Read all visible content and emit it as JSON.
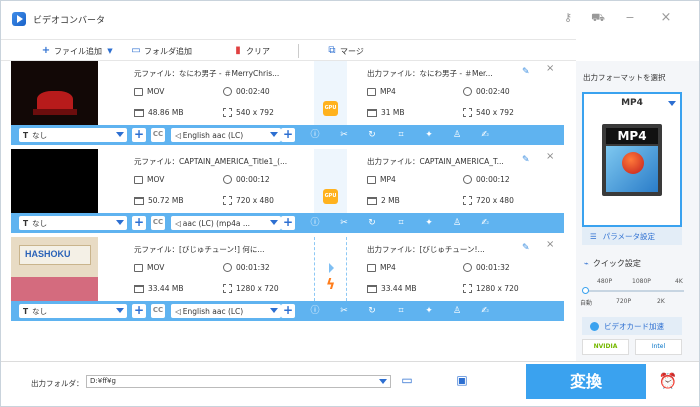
{
  "app": {
    "title": "ビデオコンバータ"
  },
  "toolbar": {
    "add_file": "ファイル追加",
    "add_folder": "フォルダ追加",
    "clear": "クリア",
    "merge": "マージ"
  },
  "files": [
    {
      "src_name": "元ファイル：なにわ男子 - ＃MerryChris...",
      "out_name": "出力ファイル：なにわ男子 - ＃Mer...",
      "src_format": "MOV",
      "src_duration": "00:02:40",
      "src_size": "48.86 MB",
      "src_resolution": "540 x 792",
      "out_format": "MP4",
      "out_duration": "00:02:40",
      "out_size": "31 MB",
      "out_resolution": "540 x 792",
      "accel": "gpu",
      "subtitle": "なし",
      "audio": "English aac (LC)"
    },
    {
      "src_name": "元ファイル：CAPTAIN_AMERICA_Title1_(...",
      "out_name": "出力ファイル：CAPTAIN_AMERICA_T...",
      "src_format": "MOV",
      "src_duration": "00:00:12",
      "src_size": "50.72 MB",
      "src_resolution": "720 x 480",
      "out_format": "MP4",
      "out_duration": "00:00:12",
      "out_size": "2 MB",
      "out_resolution": "720 x 480",
      "accel": "gpu",
      "subtitle": "なし",
      "audio": "aac (LC) (mp4a ..."
    },
    {
      "src_name": "元ファイル：[びじゅチューン!] 何に...",
      "out_name": "出力ファイル：[びじゅチューン!...",
      "src_format": "MOV",
      "src_duration": "00:01:32",
      "src_size": "33.44 MB",
      "src_resolution": "1280 x 720",
      "out_format": "MP4",
      "out_duration": "00:01:32",
      "out_size": "33.44 MB",
      "out_resolution": "1280 x 720",
      "accel": "bolt",
      "subtitle": "なし",
      "audio": "English aac (LC)"
    }
  ],
  "gpu_label": "GPU",
  "right_panel": {
    "select_format": "出力フォーマットを選択",
    "format": "MP4",
    "format_badge": "MP4",
    "param_settings": "パラメータ設定",
    "quick_settings": "クイック設定",
    "quality_labels_top": [
      "480P",
      "1080P",
      "4K"
    ],
    "quality_labels_bottom": [
      "自動",
      "720P",
      "2K"
    ],
    "video_card_accel": "ビデオカード加速",
    "vendors": [
      "NVIDIA",
      "Intel"
    ]
  },
  "footer": {
    "output_folder_label": "出力フォルダ：",
    "output_folder_value": "D:¥ff¥g",
    "convert": "変換"
  },
  "colors": {
    "accent": "#3aa2ef",
    "filter_bar": "#5fb3f0",
    "gpu": "#ffb21e"
  }
}
